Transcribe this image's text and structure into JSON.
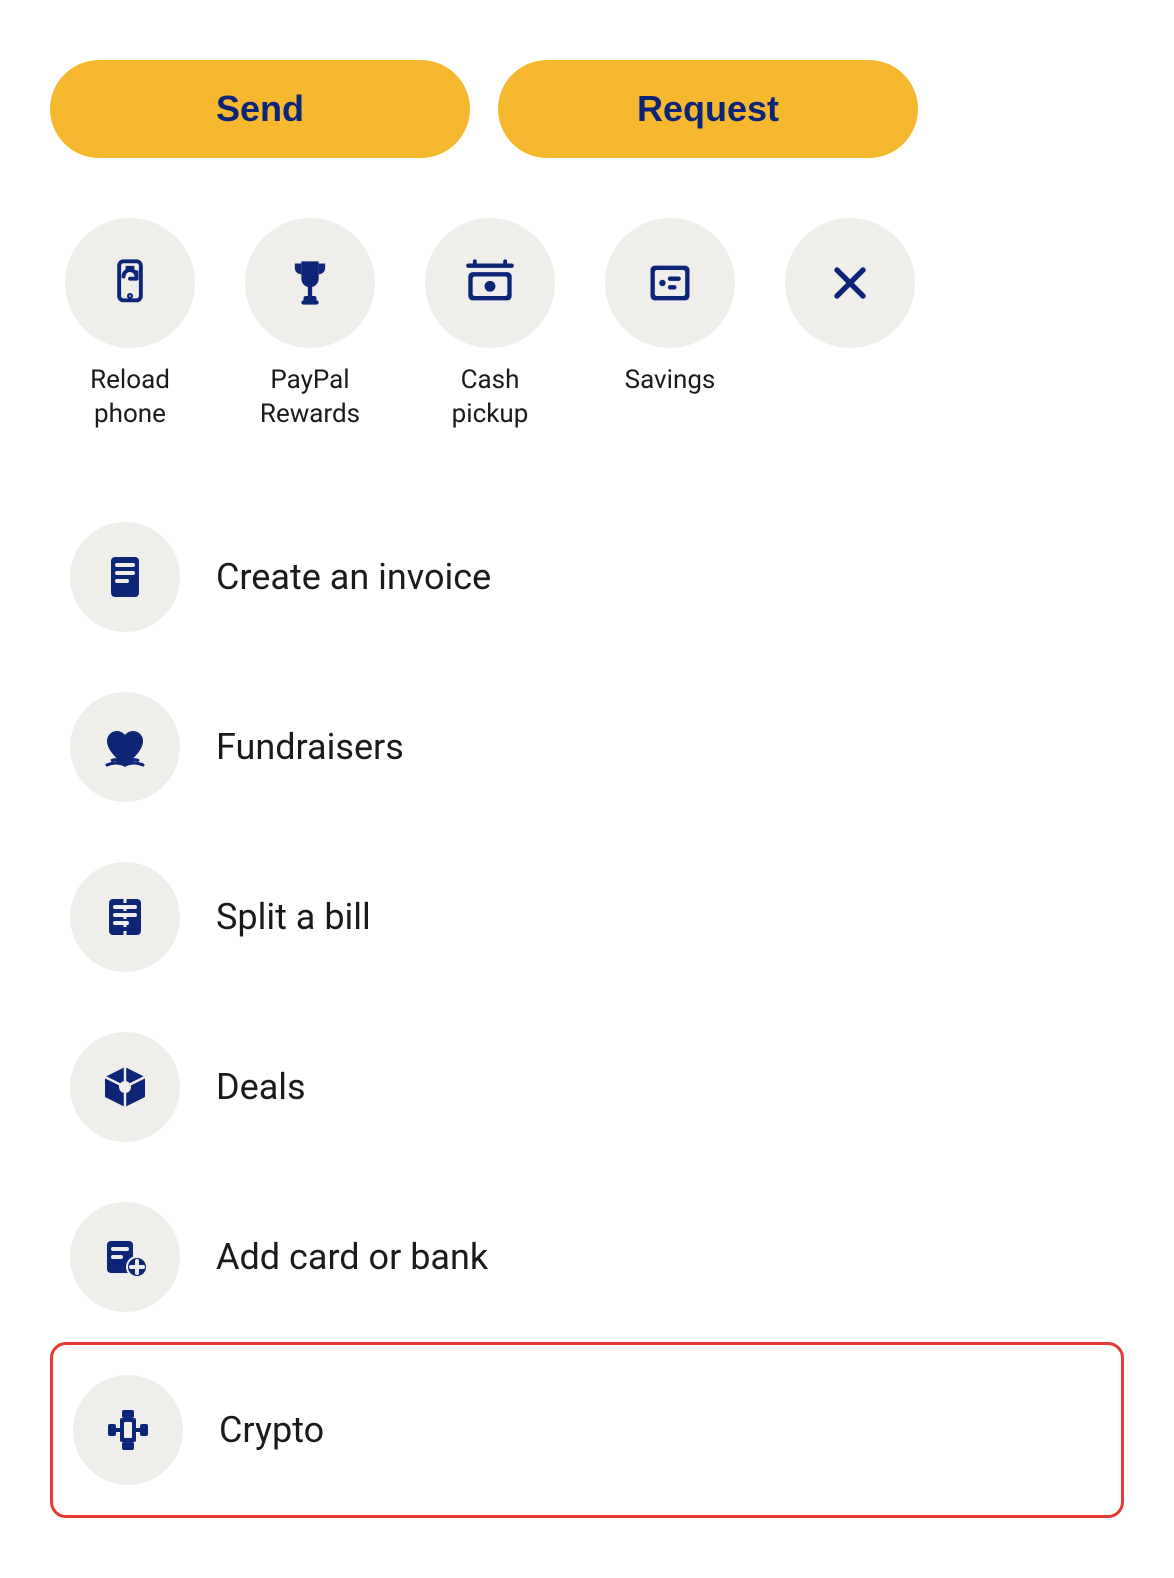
{
  "buttons": {
    "send_label": "Send",
    "request_label": "Request"
  },
  "quick_actions": [
    {
      "id": "reload-phone",
      "label": "Reload\nphone",
      "icon": "reload-phone-icon"
    },
    {
      "id": "paypal-rewards",
      "label": "PayPal\nRewards",
      "icon": "trophy-icon"
    },
    {
      "id": "cash-pickup",
      "label": "Cash\npickup",
      "icon": "cash-pickup-icon"
    },
    {
      "id": "savings",
      "label": "Savings",
      "icon": "savings-icon"
    },
    {
      "id": "close",
      "label": "",
      "icon": "close-icon"
    }
  ],
  "list_items": [
    {
      "id": "create-invoice",
      "label": "Create an invoice",
      "icon": "invoice-icon",
      "highlighted": false
    },
    {
      "id": "fundraisers",
      "label": "Fundraisers",
      "icon": "fundraisers-icon",
      "highlighted": false
    },
    {
      "id": "split-bill",
      "label": "Split a bill",
      "icon": "split-bill-icon",
      "highlighted": false
    },
    {
      "id": "deals",
      "label": "Deals",
      "icon": "deals-icon",
      "highlighted": false
    },
    {
      "id": "add-card-bank",
      "label": "Add card or bank",
      "icon": "add-card-icon",
      "highlighted": false
    },
    {
      "id": "crypto",
      "label": "Crypto",
      "icon": "crypto-icon",
      "highlighted": true
    }
  ]
}
